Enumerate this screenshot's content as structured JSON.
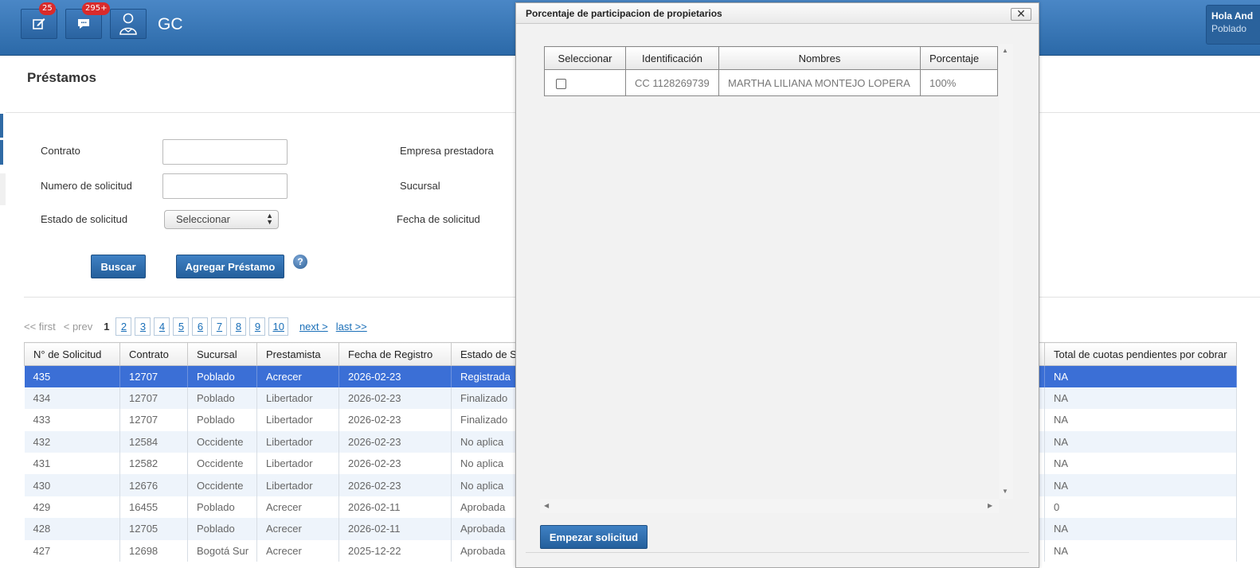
{
  "header": {
    "app_label": "GC",
    "edit_badge": "25",
    "chat_badge": "295+",
    "user_greeting": "Hola And",
    "user_branch": "Poblado"
  },
  "page": {
    "title": "Préstamos"
  },
  "filters": {
    "contrato_label": "Contrato",
    "contrato_value": "",
    "numero_label": "Numero de solicitud",
    "numero_value": "",
    "estado_label": "Estado de solicitud",
    "estado_selected": "Seleccionar",
    "empresa_label": "Empresa prestadora",
    "sucursal_label": "Sucursal",
    "fecha_label": "Fecha de solicitud"
  },
  "actions": {
    "buscar": "Buscar",
    "agregar": "Agregar Préstamo",
    "help": "?"
  },
  "pager": {
    "first": "<< first",
    "prev": "< prev",
    "current": "1",
    "pages": [
      "2",
      "3",
      "4",
      "5",
      "6",
      "7",
      "8",
      "9",
      "10"
    ],
    "next": "next >",
    "last": "last >>"
  },
  "table": {
    "headers": [
      "N° de Solicitud",
      "Contrato",
      "Sucursal",
      "Prestamista",
      "Fecha de Registro",
      "Estado de S",
      "Total de cuotas pendientes por cobrar"
    ],
    "rows": [
      [
        "435",
        "12707",
        "Poblado",
        "Acrecer",
        "2026-02-23",
        "Registrada",
        "NA"
      ],
      [
        "434",
        "12707",
        "Poblado",
        "Libertador",
        "2026-02-23",
        "Finalizado",
        "NA"
      ],
      [
        "433",
        "12707",
        "Poblado",
        "Libertador",
        "2026-02-23",
        "Finalizado",
        "NA"
      ],
      [
        "432",
        "12584",
        "Occidente",
        "Libertador",
        "2026-02-23",
        "No aplica",
        "NA"
      ],
      [
        "431",
        "12582",
        "Occidente",
        "Libertador",
        "2026-02-23",
        "No aplica",
        "NA"
      ],
      [
        "430",
        "12676",
        "Occidente",
        "Libertador",
        "2026-02-23",
        "No aplica",
        "NA"
      ],
      [
        "429",
        "16455",
        "Poblado",
        "Acrecer",
        "2026-02-11",
        "Aprobada",
        "0"
      ],
      [
        "428",
        "12705",
        "Poblado",
        "Acrecer",
        "2026-02-11",
        "Aprobada",
        "NA"
      ],
      [
        "427",
        "12698",
        "Bogotá Sur",
        "Acrecer",
        "2025-12-22",
        "Aprobada",
        "NA"
      ]
    ],
    "selected_row": 0
  },
  "modal": {
    "title": "Porcentaje de participacion de propietarios",
    "close_glyph": "✕",
    "headers": [
      "Seleccionar",
      "Identificación",
      "Nombres",
      "Porcentaje"
    ],
    "rows": [
      [
        "",
        "CC 1128269739",
        "MARTHA LILIANA MONTEJO LOPERA",
        "100%"
      ]
    ],
    "start_button": "Empezar solicitud"
  }
}
